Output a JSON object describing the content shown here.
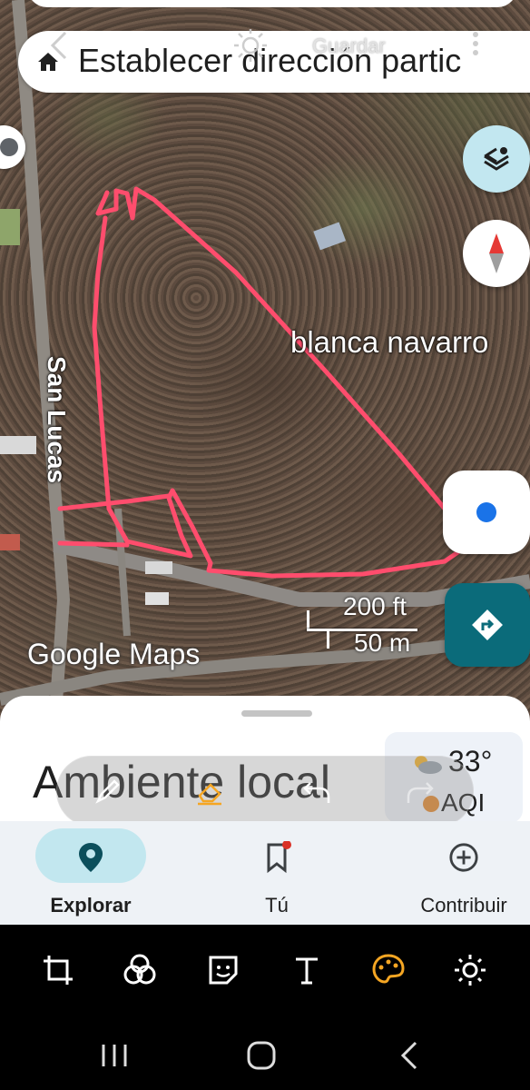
{
  "search": {
    "text": "Establecer dirección partic"
  },
  "overlay": {
    "save_label": "Guardar"
  },
  "map": {
    "place_label": "blanca navarro",
    "street_label": "San Lucas",
    "scale_ft": "200 ft",
    "scale_m": "50 m",
    "brand_google": "Google",
    "brand_maps": "Maps"
  },
  "sheet": {
    "title": "Ambiente local",
    "weather_temp": "33°",
    "weather_aqi": "AQI"
  },
  "nav": {
    "items": [
      {
        "label": "Explorar",
        "icon": "location-pin-icon",
        "selected": true
      },
      {
        "label": "Tú",
        "icon": "bookmark-icon",
        "selected": false
      },
      {
        "label": "Contribuir",
        "icon": "add-circle-icon",
        "selected": false
      }
    ]
  },
  "editor": {
    "tools": [
      "crop-rotate-icon",
      "filters-icon",
      "sticker-icon",
      "text-icon",
      "draw-icon",
      "adjust-icon"
    ]
  },
  "colors": {
    "markup_line": "#ff4d6d",
    "accent_teal": "#0b6b7a",
    "selected_pill": "#c2e7ef",
    "location_blue": "#1a73e8",
    "draw_tool_active": "#f5a623"
  }
}
